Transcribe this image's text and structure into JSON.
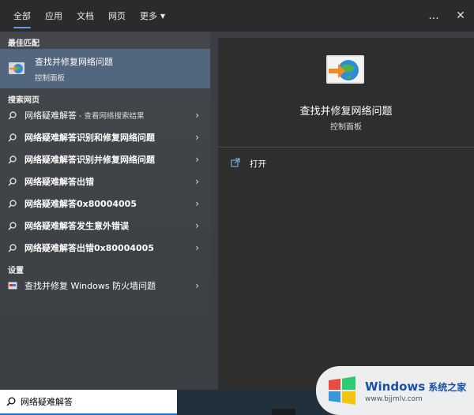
{
  "tabs": [
    {
      "label": "全部",
      "active": true
    },
    {
      "label": "应用",
      "active": false
    },
    {
      "label": "文档",
      "active": false
    },
    {
      "label": "网页",
      "active": false
    },
    {
      "label": "更多",
      "active": false
    }
  ],
  "topbar": {
    "more_icon": "...",
    "close_icon": "✕"
  },
  "best_match": {
    "section": "最佳匹配",
    "title": "查找并修复网络问题",
    "subtitle": "控制面板"
  },
  "web": {
    "section": "搜索网页",
    "items": [
      {
        "label": "网络疑难解答",
        "hint": " - 查看网络搜索结果"
      },
      {
        "label": "网络疑难解答识别和修复网络问题"
      },
      {
        "label": "网络疑难解答识别并修复网络问题"
      },
      {
        "label": "网络疑难解答出错"
      },
      {
        "label": "网络疑难解答0x80004005"
      },
      {
        "label": "网络疑难解答发生意外错误"
      },
      {
        "label": "网络疑难解答出错0x80004005"
      }
    ]
  },
  "settings": {
    "section": "设置",
    "items": [
      {
        "label": "查找并修复 Windows 防火墙问题"
      }
    ]
  },
  "preview": {
    "title": "查找并修复网络问题",
    "subtitle": "控制面板",
    "open_label": "打开"
  },
  "search": {
    "value": "网络疑难解答"
  },
  "watermark": {
    "brand": "Windows",
    "brand_suffix": "系统之家",
    "url": "www.bjjmlv.com"
  },
  "colors": {
    "accent": "#5ea0e8",
    "selected": "#52677d",
    "search_border": "#1a73d9"
  }
}
